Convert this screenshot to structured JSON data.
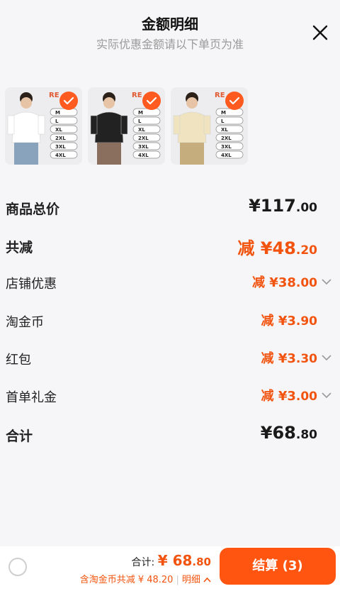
{
  "header": {
    "title": "金额明细",
    "subtitle": "实际优惠金额请以下单页为准",
    "close_icon": "close-icon"
  },
  "products": [
    {
      "brand_text": "RE",
      "sizes": [
        "M",
        "L",
        "XL",
        "2XL",
        "3XL",
        "4XL"
      ],
      "selected": true,
      "shirt_color": "#ffffff"
    },
    {
      "brand_text": "RE",
      "sizes": [
        "M",
        "L",
        "XL",
        "2XL",
        "3XL",
        "4XL"
      ],
      "selected": true,
      "shirt_color": "#222222"
    },
    {
      "brand_text": "RE",
      "sizes": [
        "M",
        "L",
        "XL",
        "2XL",
        "3XL",
        "4XL"
      ],
      "selected": true,
      "shirt_color": "#efe4bf"
    }
  ],
  "breakdown": [
    {
      "label": "商品总价",
      "value_int": "¥117",
      "value_dec": ".00",
      "bold": true,
      "orange": false,
      "chevron": false
    },
    {
      "label": "共减",
      "value_int": "减 ¥48",
      "value_dec": ".20",
      "bold": true,
      "orange": true,
      "chevron": false
    },
    {
      "label": "店铺优惠",
      "value_int": "减 ¥38",
      "value_dec": ".00",
      "bold": false,
      "orange": true,
      "chevron": true
    },
    {
      "label": "淘金币",
      "value_int": "减 ¥3",
      "value_dec": ".90",
      "bold": false,
      "orange": true,
      "chevron": false
    },
    {
      "label": "红包",
      "value_int": "减 ¥3",
      "value_dec": ".30",
      "bold": false,
      "orange": true,
      "chevron": true
    },
    {
      "label": "首单礼金",
      "value_int": "减 ¥3",
      "value_dec": ".00",
      "bold": false,
      "orange": true,
      "chevron": true
    },
    {
      "label": "合计",
      "value_int": "¥68",
      "value_dec": ".80",
      "bold": true,
      "orange": false,
      "chevron": false
    }
  ],
  "footer": {
    "total_label": "合计:",
    "total_int": "¥ 68",
    "total_dec": ".80",
    "discount_text": "含淘金币共减 ¥ 48.20",
    "detail_label": "明细",
    "checkout_label": "结算 (3)"
  },
  "colors": {
    "accent": "#ff5511",
    "discount": "#f2540f"
  }
}
